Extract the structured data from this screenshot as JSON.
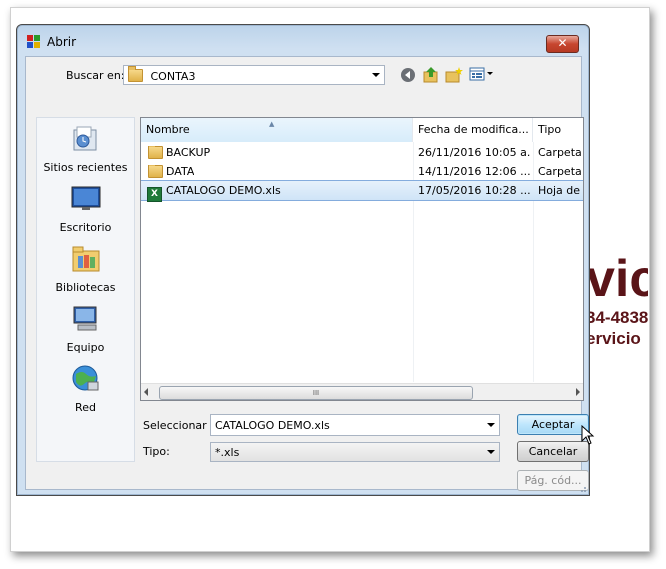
{
  "dialog": {
    "title": "Abrir",
    "close_label": "✕"
  },
  "lookin": {
    "label": "Buscar en:",
    "value": "CONTA3"
  },
  "toolbar_icons": [
    "back-icon",
    "up-folder-icon",
    "new-folder-icon",
    "view-menu-icon"
  ],
  "places": [
    {
      "label": "Sitios recientes",
      "icon": "recent-places-icon"
    },
    {
      "label": "Escritorio",
      "icon": "desktop-icon"
    },
    {
      "label": "Bibliotecas",
      "icon": "libraries-icon"
    },
    {
      "label": "Equipo",
      "icon": "computer-icon"
    },
    {
      "label": "Red",
      "icon": "network-icon"
    }
  ],
  "columns": [
    "Nombre",
    "Fecha de modifica...",
    "Tipo"
  ],
  "files": [
    {
      "name": "BACKUP",
      "date": "26/11/2016 10:05 a...",
      "type": "Carpeta d",
      "icon": "folder-icon"
    },
    {
      "name": "DATA",
      "date": "14/11/2016 12:06 ...",
      "type": "Carpeta d",
      "icon": "folder-icon"
    },
    {
      "name": "CATALOGO DEMO.xls",
      "date": "17/05/2016 10:28 ...",
      "type": "Hoja de c",
      "icon": "excel-file-icon"
    }
  ],
  "scroll_grip": "III",
  "filename": {
    "label": "Seleccionar",
    "value": "CATALOGO DEMO.xls"
  },
  "filetype": {
    "label": "Tipo:",
    "value": "*.xls"
  },
  "buttons": {
    "accept": "Aceptar",
    "cancel": "Cancelar",
    "codepage": "Pág. cód..."
  },
  "background": {
    "line1": "vic",
    "line2": "34-4838",
    "line3": "ervicio"
  }
}
